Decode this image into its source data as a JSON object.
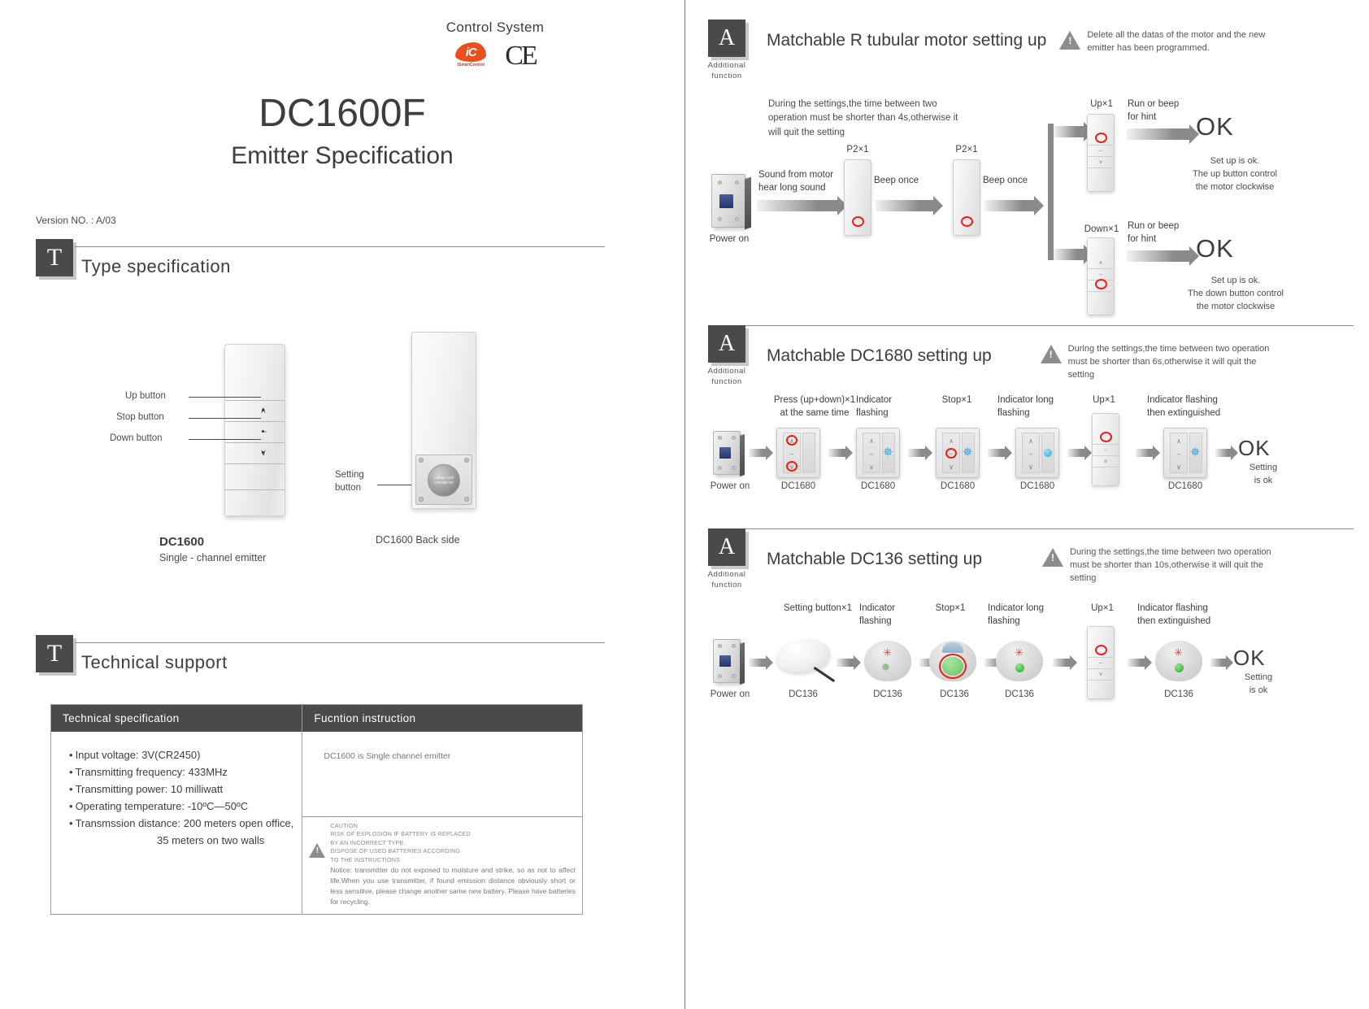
{
  "left": {
    "brand": {
      "title": "Control System",
      "logo_text": "iC",
      "logo_sub": "iSmartControl",
      "ce_mark": "CE"
    },
    "doc_title": "DC1600F",
    "doc_subtitle": "Emitter Specification",
    "version": "Version NO. : A/03",
    "section_type": {
      "badge": "T",
      "title": "Type  specification"
    },
    "section_tech": {
      "badge": "T",
      "title": "Technical  support"
    },
    "diagram": {
      "up_button": "Up  button",
      "stop_button": "Stop  button",
      "down_button": "Down  button",
      "setting_button": "Setting\nbutton",
      "setting_button_l1": "Setting",
      "setting_button_l2": "button",
      "front_caption": "DC1600",
      "front_subcaption": "Single - channel  emitter",
      "back_caption": "DC1600  Back side",
      "battery_text": "Lithium Cell CR2450 3V",
      "glyph_up": "∧",
      "glyph_stop": "–",
      "glyph_down": "∨"
    },
    "table": {
      "header_left": "Technical  specification",
      "header_right": "Fucntion  instruction",
      "specs": [
        "Input voltage:  3V(CR2450)",
        "Transmitting  frequency:  433MHz",
        "Transmitting  power:  10 milliwatt",
        "Operating  temperature:  -10ºC—50ºC",
        "Transmssion distance:  200 meters open office,"
      ],
      "spec_continuation": "35 meters on two walls",
      "function_note": "DC1600  is  Single  channel  emitter",
      "caution_lines": [
        "CAUTION",
        "RISK OF EXPLOSION IF BATTERY IS REPLACED",
        "BY AN INCORRECT TYPE.",
        "DISPOSE OF USED BATTERIES ACCORDING",
        "TO THE INSTRUCTIONS"
      ],
      "notice": "Notice: transmitter do not exposed to moisture and strike, so as not to affect life.When you use transmitter, if found emission distance obviously short or less sensitive, please change another same new battery. Please have batteries for recycling."
    }
  },
  "right": {
    "section1": {
      "badge": "A",
      "badge_caption_l1": "Additional",
      "badge_caption_l2": "function",
      "title": "Matchable  R  tubular  motor  setting  up",
      "warning": "Delete all the datas of the motor and the new emitter has been programmed.",
      "note": "During the settings,the time between two operation must be shorter than 4s,otherwise it will quit the setting",
      "power_on": "Power on",
      "step_sound_l1": "Sound  from  motor",
      "step_sound_l2": "hear  long  sound",
      "p2_label": "P2×1",
      "beep_once": "Beep  once",
      "up_label": "Up×1",
      "down_label": "Down×1",
      "run_beep_l1": "Run or beep",
      "run_beep_l2": "for hint",
      "ok": "OK",
      "ok_up_text": "Set up is ok.\nThe up button control\nthe motor clockwise",
      "ok_up_l1": "Set up is ok.",
      "ok_up_l2": "The up button control",
      "ok_up_l3": "the motor clockwise",
      "ok_down_l1": "Set up is ok.",
      "ok_down_l2": "The down button control",
      "ok_down_l3": "the motor clockwise"
    },
    "section2": {
      "badge": "A",
      "badge_caption_l1": "Additional",
      "badge_caption_l2": "function",
      "title": "Matchable  DC1680  setting  up",
      "warning": "During the settings,the time between two operation must be shorter than 6s,otherwise it will quit the setting",
      "power_on": "Power on",
      "steps": [
        {
          "label_l1": "Press  (up+down)×1",
          "label_l2": "at  the  same  time",
          "device": "DC1680"
        },
        {
          "label_l1": "Indicator",
          "label_l2": "flashing",
          "device": "DC1680"
        },
        {
          "label_l1": "Stop×1",
          "label_l2": "",
          "device": "DC1680"
        },
        {
          "label_l1": "Indicator long",
          "label_l2": "flashing",
          "device": "DC1680"
        },
        {
          "label_l1": "Up×1",
          "label_l2": "",
          "device": ""
        },
        {
          "label_l1": "Indicator flashing",
          "label_l2": "then extinguished",
          "device": "DC1680"
        }
      ],
      "ok": "OK",
      "ok_sub_l1": "Setting",
      "ok_sub_l2": "is ok"
    },
    "section3": {
      "badge": "A",
      "badge_caption_l1": "Additional",
      "badge_caption_l2": "function",
      "title": "Matchable  DC136  setting  up",
      "warning": "During the settings,the time between two operation must be shorter than 10s,otherwise it will quit the setting",
      "power_on": "Power on",
      "steps": [
        {
          "label_l1": "Setting button×1",
          "label_l2": "",
          "device": "DC136"
        },
        {
          "label_l1": "Indicator",
          "label_l2": "flashing",
          "device": "DC136"
        },
        {
          "label_l1": "Stop×1",
          "label_l2": "",
          "device": "DC136"
        },
        {
          "label_l1": "Indicator long",
          "label_l2": "flashing",
          "device": "DC136"
        },
        {
          "label_l1": "Up×1",
          "label_l2": "",
          "device": ""
        },
        {
          "label_l1": "Indicator flashing",
          "label_l2": "then extinguished",
          "device": "DC136"
        }
      ],
      "ok": "OK",
      "ok_sub_l1": "Setting",
      "ok_sub_l2": "is ok"
    }
  }
}
